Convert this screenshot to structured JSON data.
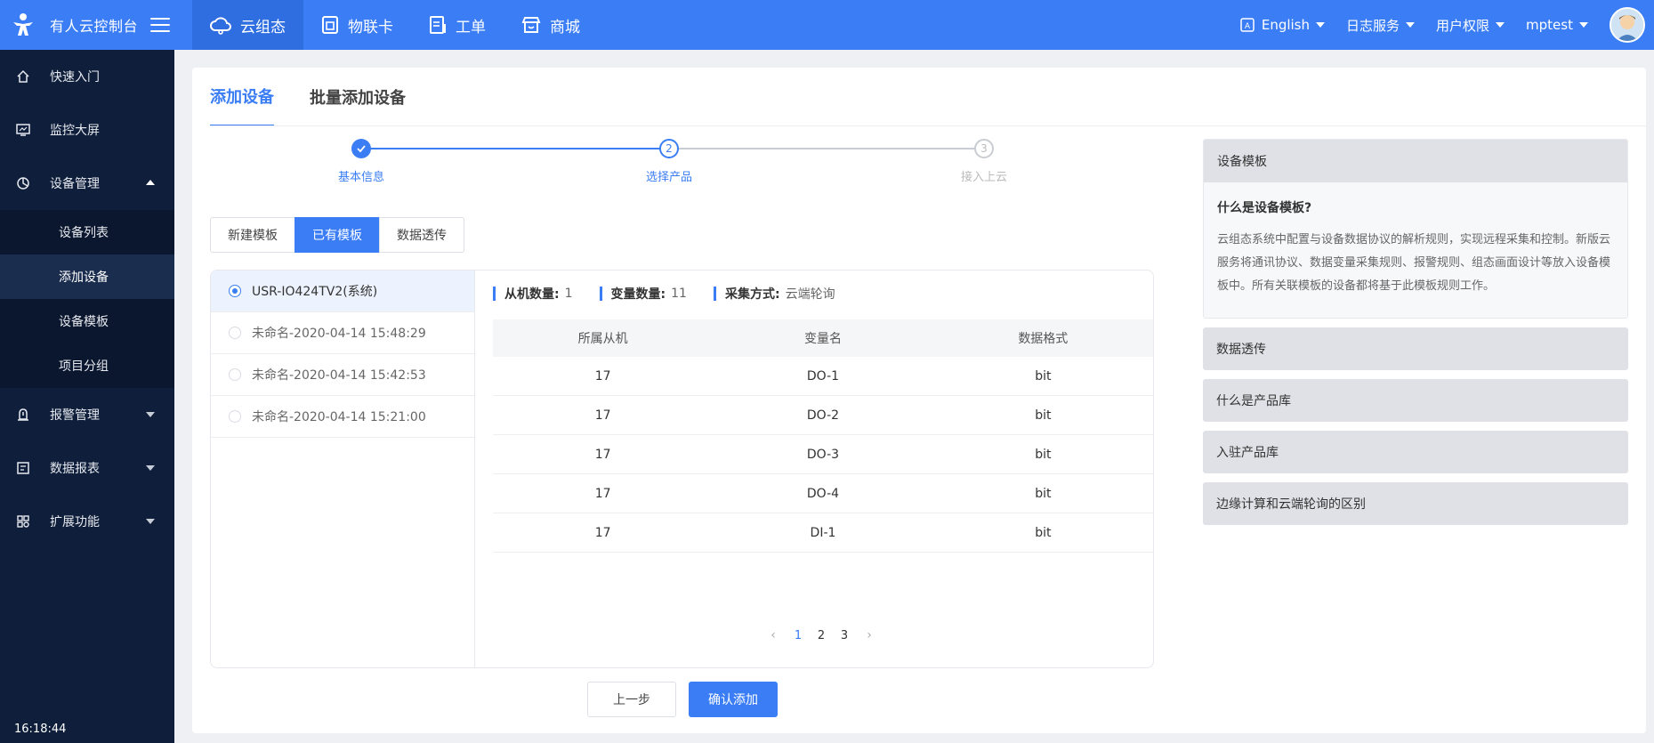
{
  "app": {
    "title": "有人云控制台",
    "nav": [
      {
        "label": "云组态",
        "icon": "cloud-icon",
        "active": true
      },
      {
        "label": "物联卡",
        "icon": "sim-card-icon",
        "active": false
      },
      {
        "label": "工单",
        "icon": "work-order-icon",
        "active": false
      },
      {
        "label": "商城",
        "icon": "store-icon",
        "active": false
      }
    ],
    "right": {
      "language": "English",
      "log_service": "日志服务",
      "user_permission": "用户权限",
      "username": "mptest"
    }
  },
  "sidebar": {
    "items": [
      {
        "label": "快速入门",
        "icon": "home-icon"
      },
      {
        "label": "监控大屏",
        "icon": "monitor-icon"
      },
      {
        "label": "设备管理",
        "icon": "device-icon",
        "expanded": true,
        "children": [
          {
            "label": "设备列表",
            "active": false
          },
          {
            "label": "添加设备",
            "active": true
          },
          {
            "label": "设备模板",
            "active": false
          },
          {
            "label": "项目分组",
            "active": false
          }
        ]
      },
      {
        "label": "报警管理",
        "icon": "alarm-icon"
      },
      {
        "label": "数据报表",
        "icon": "report-icon"
      },
      {
        "label": "扩展功能",
        "icon": "extension-icon"
      }
    ],
    "clock": "16:18:44"
  },
  "tabs": [
    {
      "label": "添加设备",
      "active": true
    },
    {
      "label": "批量添加设备",
      "active": false
    }
  ],
  "steps": [
    {
      "index": "1",
      "label": "基本信息",
      "state": "done"
    },
    {
      "index": "2",
      "label": "选择产品",
      "state": "current"
    },
    {
      "index": "3",
      "label": "接入上云",
      "state": "pending"
    }
  ],
  "template_modes": [
    {
      "label": "新建模板",
      "active": false
    },
    {
      "label": "已有模板",
      "active": true
    },
    {
      "label": "数据透传",
      "active": false
    }
  ],
  "templates": [
    {
      "name": "USR-IO424TV2(系统)",
      "selected": true
    },
    {
      "name": "未命名-2020-04-14 15:48:29",
      "selected": false
    },
    {
      "name": "未命名-2020-04-14 15:42:53",
      "selected": false
    },
    {
      "name": "未命名-2020-04-14 15:21:00",
      "selected": false
    }
  ],
  "detail": {
    "slave_count_label": "从机数量:",
    "slave_count": "1",
    "var_count_label": "变量数量:",
    "var_count": "11",
    "collect_label": "采集方式:",
    "collect_value": "云端轮询",
    "columns": [
      "所属从机",
      "变量名",
      "数据格式"
    ],
    "rows": [
      [
        "17",
        "DO-1",
        "bit"
      ],
      [
        "17",
        "DO-2",
        "bit"
      ],
      [
        "17",
        "DO-3",
        "bit"
      ],
      [
        "17",
        "DO-4",
        "bit"
      ],
      [
        "17",
        "DI-1",
        "bit"
      ]
    ],
    "pages": [
      "1",
      "2",
      "3"
    ],
    "current_page": "1"
  },
  "buttons": {
    "prev": "上一步",
    "confirm": "确认添加"
  },
  "help": {
    "open": {
      "title": "设备模板",
      "question": "什么是设备模板?",
      "answer": "云组态系统中配置与设备数据协议的解析规则，实现远程采集和控制。新版云服务将通讯协议、数据变量采集规则、报警规则、组态画面设计等放入设备模板中。所有关联模板的设备都将基于此模板规则工作。"
    },
    "collapsed": [
      "数据透传",
      "什么是产品库",
      "入驻产品库",
      "边缘计算和云端轮询的区别"
    ]
  },
  "colors": {
    "primary": "#3a7df4",
    "sidebar": "#0f1e3a",
    "pending": "#bbbbbb"
  }
}
